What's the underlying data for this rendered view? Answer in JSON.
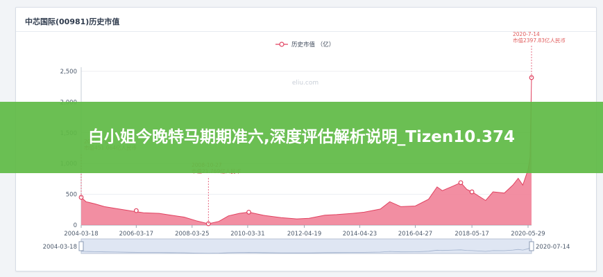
{
  "card": {
    "title": "中芯国际(00981)历史市值"
  },
  "banner": {
    "text": "白小姐今晚特马期期准六,深度评估解析说明_Tizen10.374"
  },
  "watermark": "eliu.com",
  "colors": {
    "line": "#e0415f",
    "area": "#f07a92",
    "axis": "#4d5a6c",
    "grid": "#eceef2",
    "banner": "#60ba46",
    "zoom_fill": "#dfe6f3"
  },
  "chart_data": {
    "type": "area",
    "title": "中芯国际(00981)历史市值",
    "legend": {
      "label": "历史市值 （亿）",
      "position": "top-center"
    },
    "x_ticks": [
      "2004-03-18",
      "2006-03-17",
      "2008-03-25",
      "2010-03-31",
      "2012-04-19",
      "2014-04-23",
      "2016-04-27",
      "2018-05-17",
      "2020-05-29"
    ],
    "y_ticks": [
      "0",
      "500",
      "1,000",
      "1,500",
      "2,000",
      "2,500"
    ],
    "ylim": [
      0,
      2500
    ],
    "xlim": [
      "2004-03-18",
      "2020-07-14"
    ],
    "grid": true,
    "series": [
      {
        "name": "历史市值",
        "points": [
          [
            "2004-03-18",
            451
          ],
          [
            "2004-05-20",
            380
          ],
          [
            "2004-09-15",
            345
          ],
          [
            "2005-01-20",
            300
          ],
          [
            "2005-06-15",
            270
          ],
          [
            "2006-01-10",
            230
          ],
          [
            "2006-06-20",
            200
          ],
          [
            "2007-01-15",
            190
          ],
          [
            "2007-06-20",
            160
          ],
          [
            "2007-12-10",
            130
          ],
          [
            "2008-05-20",
            70
          ],
          [
            "2008-10-27",
            21.8
          ],
          [
            "2009-03-15",
            60
          ],
          [
            "2009-07-20",
            150
          ],
          [
            "2009-12-10",
            190
          ],
          [
            "2010-04-15",
            210
          ],
          [
            "2010-10-20",
            160
          ],
          [
            "2011-06-15",
            120
          ],
          [
            "2012-01-10",
            100
          ],
          [
            "2012-06-20",
            110
          ],
          [
            "2013-01-15",
            160
          ],
          [
            "2013-06-20",
            170
          ],
          [
            "2014-01-15",
            190
          ],
          [
            "2014-06-20",
            210
          ],
          [
            "2015-01-20",
            260
          ],
          [
            "2015-05-25",
            380
          ],
          [
            "2015-10-20",
            300
          ],
          [
            "2016-04-27",
            310
          ],
          [
            "2016-10-20",
            420
          ],
          [
            "2017-02-10",
            620
          ],
          [
            "2017-04-20",
            560
          ],
          [
            "2017-09-20",
            640
          ],
          [
            "2017-12-20",
            690
          ],
          [
            "2018-03-10",
            580
          ],
          [
            "2018-05-17",
            540
          ],
          [
            "2018-11-15",
            400
          ],
          [
            "2019-02-20",
            540
          ],
          [
            "2019-07-20",
            520
          ],
          [
            "2019-11-10",
            650
          ],
          [
            "2020-01-20",
            760
          ],
          [
            "2020-03-20",
            650
          ],
          [
            "2020-05-29",
            900
          ],
          [
            "2020-06-25",
            1100
          ],
          [
            "2020-07-14",
            2397.83
          ]
        ]
      }
    ],
    "markers": [
      {
        "date": "2004-03-18",
        "value": 451
      },
      {
        "date": "2006-03-17",
        "value": 235
      },
      {
        "date": "2008-10-27",
        "value": 21.8
      },
      {
        "date": "2010-04-15",
        "value": 210
      },
      {
        "date": "2017-12-20",
        "value": 690
      },
      {
        "date": "2018-05-17",
        "value": 540
      },
      {
        "date": "2020-07-14",
        "value": 2397.83
      }
    ],
    "annotations": [
      {
        "id": "a2004",
        "date_label": "2004-3-18",
        "value_label": "市值451.064亿人民币"
      },
      {
        "id": "a2008",
        "date_label": "2008-10-27",
        "value_label": "市值21.769亿人民币"
      },
      {
        "id": "a2020",
        "date_label": "2020-7-14",
        "value_label": "市值2397.83亿人民币"
      }
    ],
    "zoom_labels": {
      "start": "2004-03-18",
      "end": "2020-07-14"
    }
  }
}
